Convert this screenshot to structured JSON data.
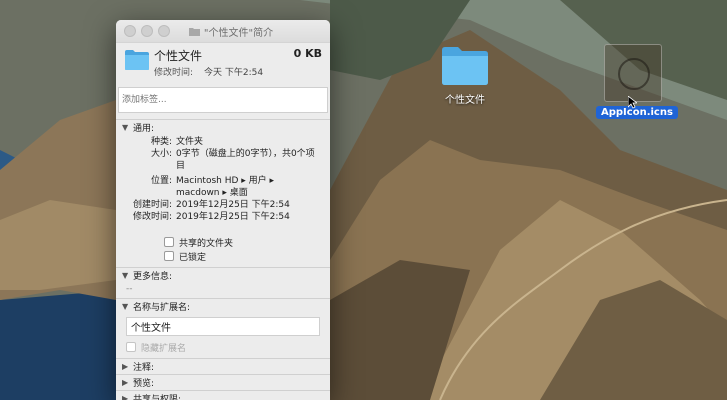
{
  "window": {
    "title": "\"个性文件\"简介",
    "name": "个性文件",
    "size": "0 KB",
    "modified_label": "修改时间:",
    "modified_value": "今天 下午2:54",
    "tags_placeholder": "添加标签..."
  },
  "general": {
    "header": "通用:",
    "rows": [
      {
        "k": "种类:",
        "v": "文件夹"
      },
      {
        "k": "大小:",
        "v": "0字节（磁盘上的0字节），共0个项目"
      },
      {
        "k": "位置:",
        "v": "Macintosh HD ▸ 用户 ▸ macdown ▸ 桌面"
      },
      {
        "k": "创建时间:",
        "v": "2019年12月25日 下午2:54"
      },
      {
        "k": "修改时间:",
        "v": "2019年12月25日 下午2:54"
      }
    ],
    "shared_folder": "共享的文件夹",
    "locked": "已锁定"
  },
  "more_info": {
    "header": "更多信息:",
    "value": "--"
  },
  "name_ext": {
    "header": "名称与扩展名:",
    "value": "个性文件",
    "hide_ext": "隐藏扩展名"
  },
  "collapsed": {
    "comments": "注释:",
    "preview": "预览:",
    "sharing": "共享与权限:"
  },
  "desktop": {
    "folder_label": "个性文件",
    "file_label": "AppIcon.icns"
  },
  "colors": {
    "folder": "#5ab8f0",
    "selection": "#1f64d6"
  }
}
